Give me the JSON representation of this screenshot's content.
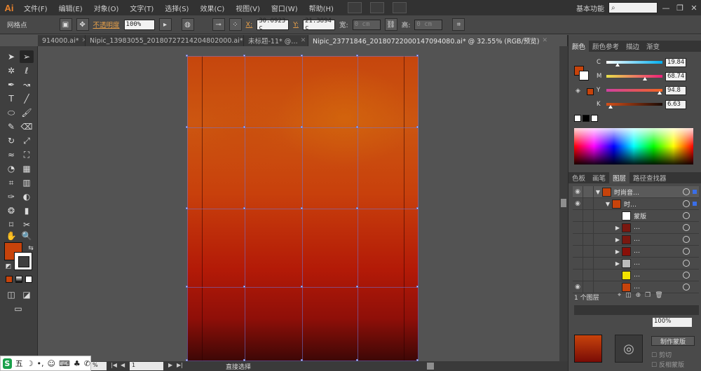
{
  "app": {
    "logo": "Ai"
  },
  "menu": [
    "文件(F)",
    "编辑(E)",
    "对象(O)",
    "文字(T)",
    "选择(S)",
    "效果(C)",
    "视图(V)",
    "窗口(W)",
    "帮助(H)"
  ],
  "workspace": "基本功能",
  "window_controls": {
    "minimize": "—",
    "restore": "❐",
    "close": "✕"
  },
  "control_bar": {
    "selection_label": "网格点",
    "opacity_label": "不透明度",
    "opacity_value": "100%",
    "x_label": "X:",
    "x_value": "30.0923 c",
    "y_label": "Y:",
    "y_value": "21.3894 c",
    "width_label": "宽:",
    "width_value": "0 cm",
    "height_label": "高:",
    "height_value": "0 cm"
  },
  "tabs": [
    {
      "label": "914000.ai*",
      "active": false
    },
    {
      "label": "Nipic_13983055_20180727214204802000.ai*",
      "active": false
    },
    {
      "label": "未标题-11* @…",
      "active": false
    },
    {
      "label": "Nipic_23771846_20180722000147094080.ai* @ 32.55% (RGB/预览)",
      "active": true
    }
  ],
  "status_bar": {
    "zoom": "%",
    "page": "1",
    "tool": "直接选择"
  },
  "ime": {
    "logo": "S",
    "mode": "五"
  },
  "color_panel": {
    "tabs": [
      {
        "label": "颜色",
        "active": true
      },
      {
        "label": "颜色参考",
        "active": false
      },
      {
        "label": "描边",
        "active": false
      },
      {
        "label": "渐变",
        "active": false
      }
    ],
    "channels": [
      {
        "label": "C",
        "value": "19.84",
        "fraction": 0.2
      },
      {
        "label": "M",
        "value": "68.74",
        "fraction": 0.69
      },
      {
        "label": "Y",
        "value": "94.8",
        "fraction": 0.95
      },
      {
        "label": "K",
        "value": "6.63",
        "fraction": 0.07
      }
    ],
    "fill_color": "#c7430b"
  },
  "layers_panel": {
    "tabs": [
      {
        "label": "色板",
        "active": false
      },
      {
        "label": "画笔",
        "active": false
      },
      {
        "label": "图层",
        "active": true
      },
      {
        "label": "路径查找器",
        "active": false
      }
    ],
    "rows": [
      {
        "name": "时尚音…",
        "eye": "◉",
        "arrow": "▼",
        "sel": true
      },
      {
        "name": "时…",
        "eye": "◉",
        "arrow": "▼",
        "sel": false
      },
      {
        "name": "蒙版",
        "eye": "",
        "arrow": "",
        "sel": false
      },
      {
        "name": "…",
        "eye": "",
        "arrow": "▶",
        "sel": false
      },
      {
        "name": "…",
        "eye": "",
        "arrow": "▶",
        "sel": false
      },
      {
        "name": "…",
        "eye": "",
        "arrow": "▶",
        "sel": false
      },
      {
        "name": "…",
        "eye": "",
        "arrow": "▶",
        "sel": false
      },
      {
        "name": "…",
        "eye": "",
        "arrow": "",
        "sel": false
      },
      {
        "name": "…",
        "eye": "◉",
        "arrow": "",
        "sel": false
      }
    ],
    "count_label": "1 个图层"
  },
  "transparency_panel": {
    "opacity_value": "100%",
    "make_mask_label": "制作蒙版",
    "clip_label": "剪切",
    "invert_label": "反相蒙版"
  }
}
